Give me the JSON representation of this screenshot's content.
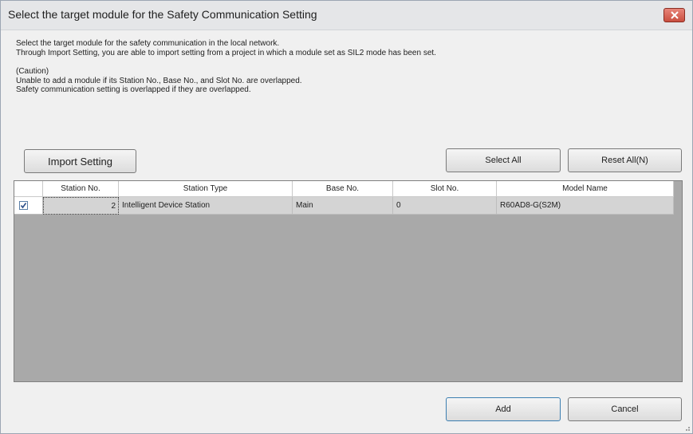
{
  "dialog": {
    "title": "Select the target module for the Safety Communication Setting",
    "close_icon": "close-icon"
  },
  "info": {
    "line1": "Select the target module for the safety communication in the local network.",
    "line2": "Through Import Setting, you are able to import setting from a project in which a module set as SIL2 mode has been set.",
    "caution_heading": "(Caution)",
    "caution_line1": "Unable to add a module if its Station No., Base No., and Slot No. are overlapped.",
    "caution_line2": "Safety communication setting is overlapped if they are overlapped."
  },
  "buttons": {
    "import_setting": "Import Setting",
    "select_all": "Select All",
    "reset_all": "Reset All(N)",
    "add": "Add",
    "cancel": "Cancel"
  },
  "table": {
    "columns": [
      "",
      "Station No.",
      "Station Type",
      "Base No.",
      "Slot No.",
      "Model Name"
    ],
    "rows": [
      {
        "checked": true,
        "station_no": "2",
        "station_type": "Intelligent Device Station",
        "base_no": "Main",
        "slot_no": "0",
        "model_name": "R60AD8-G(S2M)"
      }
    ]
  },
  "colors": {
    "close_button": "#c94f40",
    "grid_background": "#a9a9a9",
    "row_background": "#d4d4d4"
  }
}
